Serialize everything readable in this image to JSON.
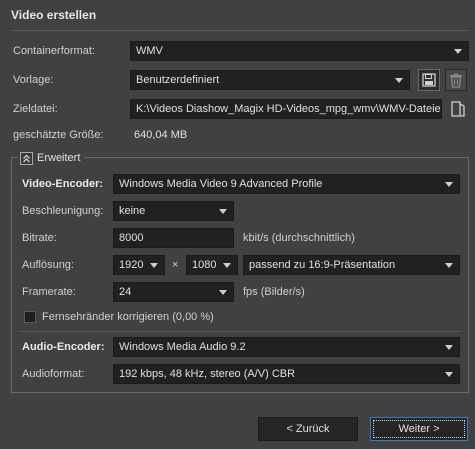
{
  "dialog": {
    "title": "Video erstellen"
  },
  "fields": {
    "container_label": "Containerformat:",
    "container_value": "WMV",
    "preset_label": "Vorlage:",
    "preset_value": "Benutzerdefiniert",
    "target_label": "Zieldatei:",
    "target_value": "K:\\Videos Diashow_Magix  HD-Videos_mpg_wmv\\WMV-Dateien\\",
    "size_label": "geschätzte Größe:",
    "size_value": "640,04 MB"
  },
  "advanced": {
    "header": "Erweitert",
    "video_encoder_label": "Video-Encoder:",
    "video_encoder_value": "Windows Media Video 9 Advanced Profile",
    "accel_label": "Beschleunigung:",
    "accel_value": "keine",
    "bitrate_label": "Bitrate:",
    "bitrate_value": "8000",
    "bitrate_unit": "kbit/s (durchschnittlich)",
    "resolution_label": "Auflösung:",
    "resolution_width": "1920",
    "resolution_x": "×",
    "resolution_height": "1080",
    "resolution_preset": "passend zu 16:9-Präsentation",
    "framerate_label": "Framerate:",
    "framerate_value": "24",
    "framerate_unit": "fps (Bilder/s)",
    "tv_border_label": "Fernsehränder korrigieren (0,00 %)",
    "audio_encoder_label": "Audio-Encoder:",
    "audio_encoder_value": "Windows Media Audio 9.2",
    "audio_format_label": "Audioformat:",
    "audio_format_value": "192 kbps, 48 kHz, stereo (A/V) CBR"
  },
  "buttons": {
    "back": "< Zurück",
    "next": "Weiter >"
  }
}
